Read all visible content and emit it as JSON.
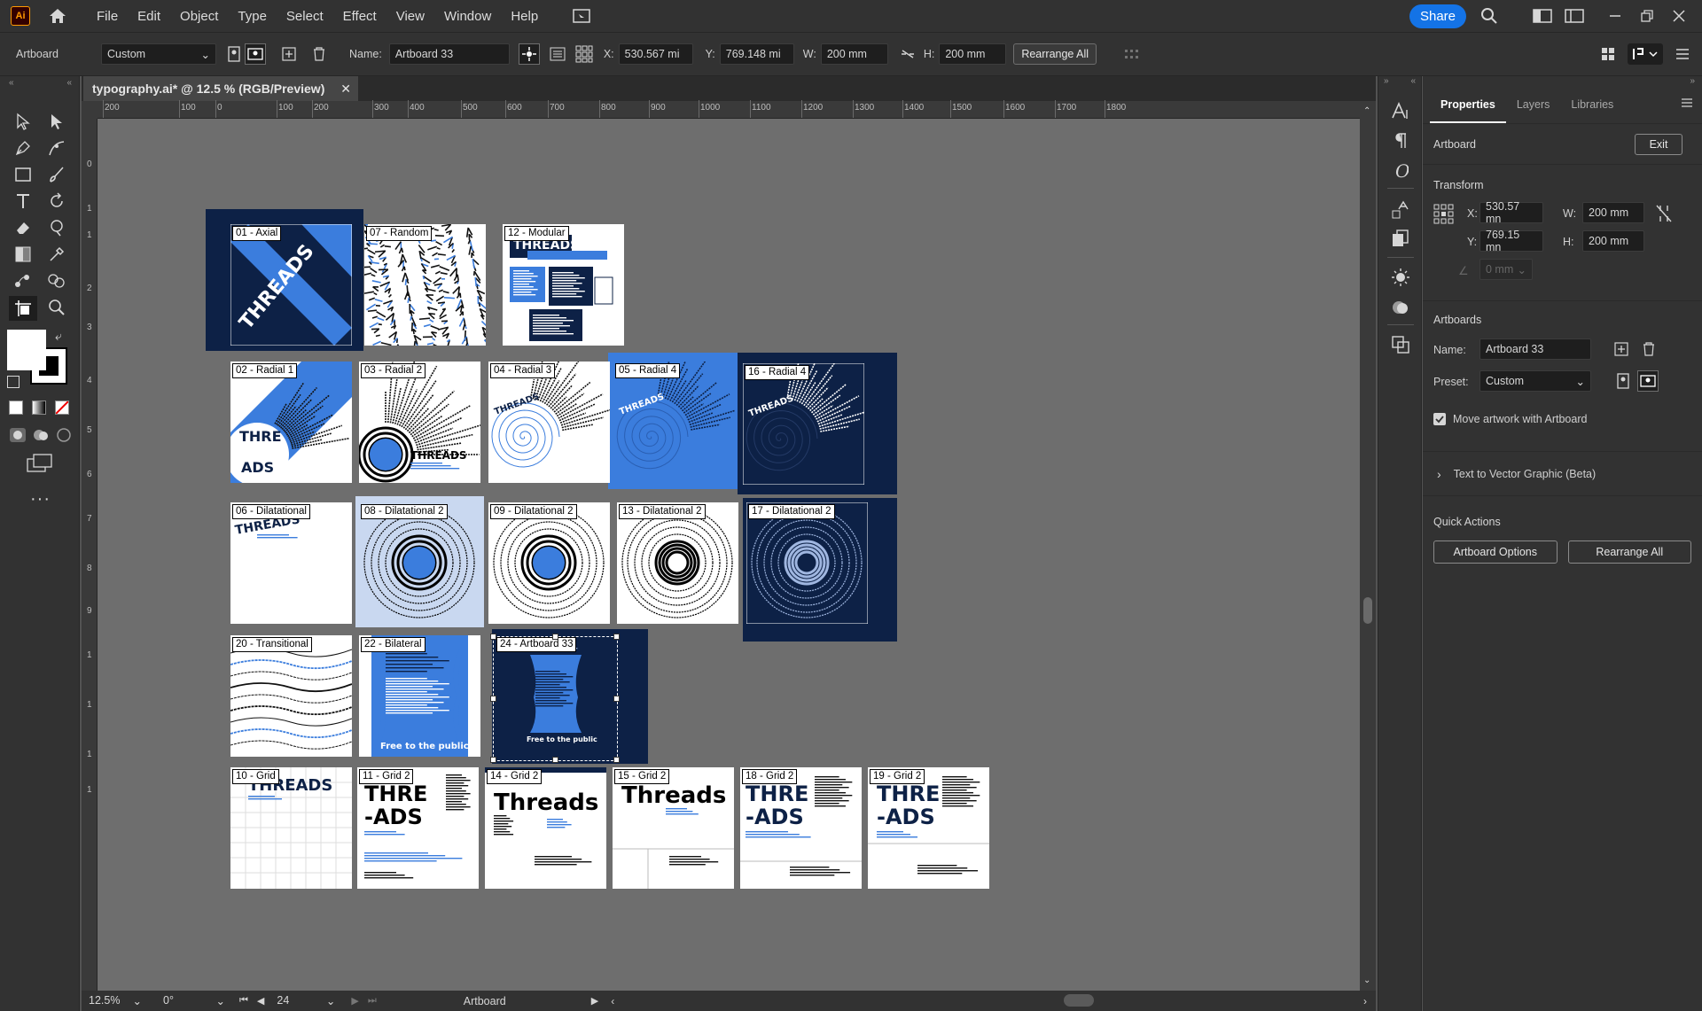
{
  "menubar": {
    "logo": "Ai",
    "items": [
      "File",
      "Edit",
      "Object",
      "Type",
      "Select",
      "Effect",
      "View",
      "Window",
      "Help"
    ],
    "share_label": "Share"
  },
  "control_bar": {
    "context": "Artboard",
    "preset": "Custom",
    "name_label": "Name:",
    "name_value": "Artboard 33",
    "x_label": "X:",
    "x_value": "530.567 mi",
    "y_label": "Y:",
    "y_value": "769.148 mi",
    "w_label": "W:",
    "w_value": "200 mm",
    "h_label": "H:",
    "h_value": "200 mm",
    "rearrange_label": "Rearrange All"
  },
  "document": {
    "tab_title": "typography.ai* @ 12.5 % (RGB/Preview)",
    "close": "✕"
  },
  "ruler_h": [
    "200",
    "100",
    "0",
    "100",
    "200",
    "300",
    "400",
    "500",
    "600",
    "700",
    "800",
    "900",
    "1000",
    "1100",
    "1200",
    "1300",
    "1400",
    "1500",
    "1600",
    "1700",
    "1800"
  ],
  "ruler_v": [
    "0",
    "1",
    "1",
    "2",
    "3",
    "4",
    "5",
    "6",
    "7",
    "8",
    "9",
    "1",
    "1",
    "1",
    "1"
  ],
  "artboards": [
    {
      "label": "01 - Axial",
      "style": "axial",
      "text": "THREADS"
    },
    {
      "label": "07 - Random",
      "style": "random",
      "text": ""
    },
    {
      "label": "12 - Modular",
      "style": "modular",
      "text": "THREADS"
    },
    {
      "label": "02 - Radial 1",
      "style": "radial1",
      "text": "THREADS"
    },
    {
      "label": "03 - Radial 2",
      "style": "radial2",
      "text": "THREADS"
    },
    {
      "label": "04 - Radial 3",
      "style": "radial3",
      "text": "THREADS"
    },
    {
      "label": "05 - Radial 4",
      "style": "radial4blue",
      "text": "THREADS"
    },
    {
      "label": "16 - Radial 4",
      "style": "radial4navy",
      "text": "THREADS"
    },
    {
      "label": "06 - Dilatational",
      "style": "dil1",
      "text": "THREADS"
    },
    {
      "label": "08 - Dilatational 2",
      "style": "dilblue",
      "text": ""
    },
    {
      "label": "09 - Dilatational 2",
      "style": "dilwhite",
      "text": ""
    },
    {
      "label": "13 - Dilatational 2",
      "style": "dilmono",
      "text": ""
    },
    {
      "label": "17 - Dilatational 2",
      "style": "dilnavy",
      "text": ""
    },
    {
      "label": "20 - Transitional",
      "style": "trans",
      "text": ""
    },
    {
      "label": "22 - Bilateral",
      "style": "bilat",
      "text": "Free to the public"
    },
    {
      "label": "24 - Artboard 33",
      "style": "bilatnavy",
      "text": "Free to the public"
    },
    {
      "label": "10 - Grid",
      "style": "grid1",
      "text": "THREADS"
    },
    {
      "label": "11 - Grid 2",
      "style": "grid2",
      "text": "THRE -ADS"
    },
    {
      "label": "14 - Grid 2",
      "style": "grid3",
      "text": "Threads"
    },
    {
      "label": "15 - Grid 2",
      "style": "grid4",
      "text": "Threads"
    },
    {
      "label": "18 - Grid 2",
      "style": "grid5",
      "text": "THRE -ADS"
    },
    {
      "label": "19 - Grid 2",
      "style": "grid6",
      "text": "THRE -ADS"
    }
  ],
  "status": {
    "zoom": "12.5%",
    "rotation": "0°",
    "artboard_num": "24",
    "mode": "Artboard"
  },
  "panel": {
    "tabs": [
      "Properties",
      "Layers",
      "Libraries"
    ],
    "context": "Artboard",
    "exit_label": "Exit",
    "transform_title": "Transform",
    "x_label": "X:",
    "x_value": "530.57 mn",
    "y_label": "Y:",
    "y_value": "769.15 mn",
    "w_label": "W:",
    "w_value": "200 mm",
    "h_label": "H:",
    "h_value": "200 mm",
    "angle_value": "0 mm",
    "artboards_title": "Artboards",
    "name_label": "Name:",
    "name_value": "Artboard 33",
    "preset_label": "Preset:",
    "preset_value": "Custom",
    "move_artwork_label": "Move artwork with Artboard",
    "text_vector_label": "Text to Vector Graphic (Beta)",
    "quick_actions_title": "Quick Actions",
    "artboard_options_label": "Artboard Options",
    "rearrange_label": "Rearrange All"
  },
  "colors": {
    "accent": "#1473e6",
    "navy": "#0d2146",
    "blue": "#3b7ddd"
  }
}
